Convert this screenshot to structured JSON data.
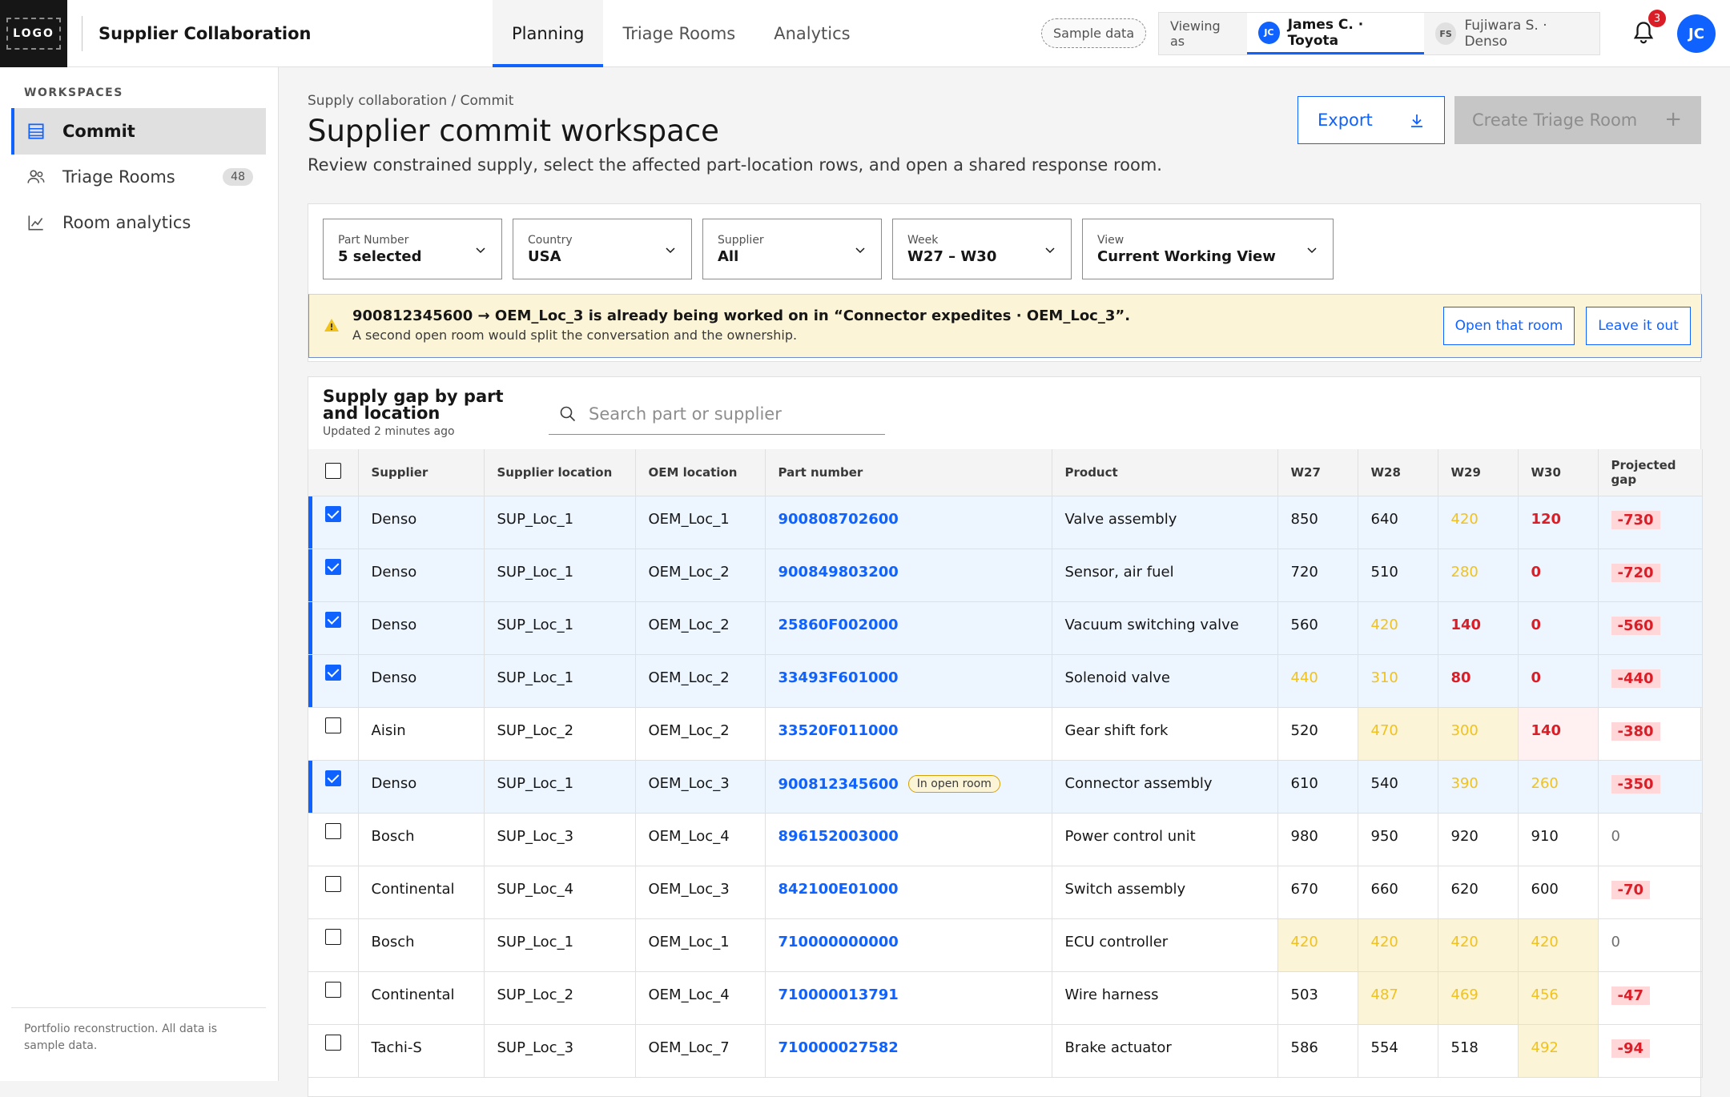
{
  "app": {
    "logo": "LOGO",
    "title": "Supplier Collaboration"
  },
  "nav": {
    "tabs": [
      "Planning",
      "Triage Rooms",
      "Analytics"
    ],
    "active": "Planning"
  },
  "header": {
    "sample_label": "Sample data",
    "viewing_label": "Viewing as",
    "personas": [
      {
        "initials": "JC",
        "name": "James C. · Toyota",
        "active": true
      },
      {
        "initials": "FS",
        "name": "Fujiwara S. · Denso",
        "active": false
      }
    ],
    "notifications": "3",
    "avatar": "JC"
  },
  "sidebar": {
    "section_label": "WORKSPACES",
    "items": [
      {
        "label": "Commit",
        "icon": "list-icon",
        "active": true
      },
      {
        "label": "Triage Rooms",
        "icon": "people-icon",
        "count": "48"
      },
      {
        "label": "Room analytics",
        "icon": "chart-icon"
      }
    ],
    "footer": "Portfolio reconstruction. All data is sample data."
  },
  "page": {
    "breadcrumb": "Supply collaboration / Commit",
    "title": "Supplier commit workspace",
    "subtitle": "Review constrained supply, select the affected part-location rows, and open a shared response room.",
    "export_label": "Export",
    "create_label": "Create Triage Room",
    "create_icon": "+"
  },
  "filters": [
    {
      "label": "Part Number",
      "value": "5 selected"
    },
    {
      "label": "Country",
      "value": "USA"
    },
    {
      "label": "Supplier",
      "value": "All"
    },
    {
      "label": "Week",
      "value": "W27 – W30"
    },
    {
      "label": "View",
      "value": "Current Working View"
    }
  ],
  "warning": {
    "title": "900812345600 → OEM_Loc_3 is already being worked on in “Connector expedites · OEM_Loc_3”.",
    "subtitle": "A second open room would split the conversation and the ownership.",
    "open_label": "Open that room",
    "leave_label": "Leave it out"
  },
  "table": {
    "title": "Supply gap by part and location",
    "updated": "Updated 2 minutes ago",
    "search_placeholder": "Search part or supplier",
    "columns": [
      "Supplier",
      "Supplier location",
      "OEM location",
      "Part number",
      "Product",
      "W27",
      "W28",
      "W29",
      "W30",
      "Projected gap"
    ],
    "status_colors": {
      "selected": "#edf5ff",
      "warn": "#fcf4d6",
      "critical": "#fff1f1"
    },
    "rows": [
      {
        "checked": true,
        "supplier": "Denso",
        "sup_loc": "SUP_Loc_1",
        "oem_loc": "OEM_Loc_1",
        "part": "900808702600",
        "product": "Valve assembly",
        "w": [
          "850",
          "640",
          "420",
          "120"
        ],
        "ws": [
          "",
          "",
          "amber",
          "red"
        ],
        "bg": [
          "",
          "",
          "",
          ""
        ],
        "gap": "-730"
      },
      {
        "checked": true,
        "supplier": "Denso",
        "sup_loc": "SUP_Loc_1",
        "oem_loc": "OEM_Loc_2",
        "part": "900849803200",
        "product": "Sensor, air fuel",
        "w": [
          "720",
          "510",
          "280",
          "0"
        ],
        "ws": [
          "",
          "",
          "amber",
          "red"
        ],
        "bg": [
          "",
          "",
          "",
          ""
        ],
        "gap": "-720"
      },
      {
        "checked": true,
        "supplier": "Denso",
        "sup_loc": "SUP_Loc_1",
        "oem_loc": "OEM_Loc_2",
        "part": "25860F002000",
        "product": "Vacuum switching valve",
        "w": [
          "560",
          "420",
          "140",
          "0"
        ],
        "ws": [
          "",
          "amber",
          "red",
          "red"
        ],
        "bg": [
          "",
          "",
          "",
          ""
        ],
        "gap": "-560"
      },
      {
        "checked": true,
        "supplier": "Denso",
        "sup_loc": "SUP_Loc_1",
        "oem_loc": "OEM_Loc_2",
        "part": "33493F601000",
        "product": "Solenoid valve",
        "w": [
          "440",
          "310",
          "80",
          "0"
        ],
        "ws": [
          "amber",
          "amber",
          "red",
          "red"
        ],
        "bg": [
          "",
          "",
          "",
          ""
        ],
        "gap": "-440"
      },
      {
        "checked": false,
        "supplier": "Aisin",
        "sup_loc": "SUP_Loc_2",
        "oem_loc": "OEM_Loc_2",
        "part": "33520F011000",
        "product": "Gear shift fork",
        "w": [
          "520",
          "470",
          "300",
          "140"
        ],
        "ws": [
          "",
          "amber",
          "amber",
          "red"
        ],
        "bg": [
          "",
          "bgY",
          "bgY",
          "bgR"
        ],
        "gap": "-380"
      },
      {
        "checked": true,
        "supplier": "Denso",
        "sup_loc": "SUP_Loc_1",
        "oem_loc": "OEM_Loc_3",
        "part": "900812345600",
        "badge": "In open room",
        "product": "Connector assembly",
        "w": [
          "610",
          "540",
          "390",
          "260"
        ],
        "ws": [
          "",
          "",
          "amber",
          "amber"
        ],
        "bg": [
          "",
          "",
          "",
          ""
        ],
        "gap": "-350"
      },
      {
        "checked": false,
        "supplier": "Bosch",
        "sup_loc": "SUP_Loc_3",
        "oem_loc": "OEM_Loc_4",
        "part": "896152003000",
        "product": "Power control unit",
        "w": [
          "980",
          "950",
          "920",
          "910"
        ],
        "ws": [
          "",
          "",
          "",
          ""
        ],
        "bg": [
          "",
          "",
          "",
          ""
        ],
        "gap": "0"
      },
      {
        "checked": false,
        "supplier": "Continental",
        "sup_loc": "SUP_Loc_4",
        "oem_loc": "OEM_Loc_3",
        "part": "842100E01000",
        "product": "Switch assembly",
        "w": [
          "670",
          "660",
          "620",
          "600"
        ],
        "ws": [
          "",
          "",
          "",
          ""
        ],
        "bg": [
          "",
          "",
          "",
          ""
        ],
        "gap": "-70"
      },
      {
        "checked": false,
        "supplier": "Bosch",
        "sup_loc": "SUP_Loc_1",
        "oem_loc": "OEM_Loc_1",
        "part": "710000000000",
        "product": "ECU controller",
        "w": [
          "420",
          "420",
          "420",
          "420"
        ],
        "ws": [
          "amber",
          "amber",
          "amber",
          "amber"
        ],
        "bg": [
          "bgY",
          "bgY",
          "bgY",
          "bgY"
        ],
        "gap": "0"
      },
      {
        "checked": false,
        "supplier": "Continental",
        "sup_loc": "SUP_Loc_2",
        "oem_loc": "OEM_Loc_4",
        "part": "710000013791",
        "product": "Wire harness",
        "w": [
          "503",
          "487",
          "469",
          "456"
        ],
        "ws": [
          "",
          "amber",
          "amber",
          "amber"
        ],
        "bg": [
          "",
          "bgY",
          "bgY",
          "bgY"
        ],
        "gap": "-47"
      },
      {
        "checked": false,
        "supplier": "Tachi-S",
        "sup_loc": "SUP_Loc_3",
        "oem_loc": "OEM_Loc_7",
        "part": "710000027582",
        "product": "Brake actuator",
        "w": [
          "586",
          "554",
          "518",
          "492"
        ],
        "ws": [
          "",
          "",
          "",
          "amber"
        ],
        "bg": [
          "",
          "",
          "",
          "bgY"
        ],
        "gap": "-94"
      }
    ]
  }
}
